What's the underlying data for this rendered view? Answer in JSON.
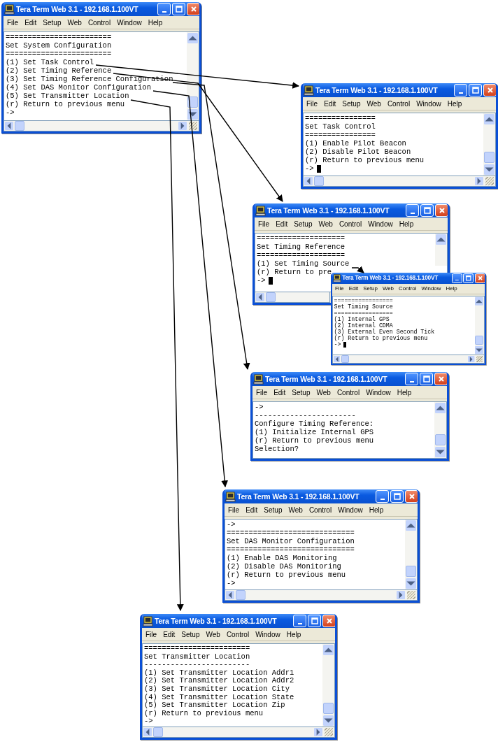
{
  "windows": [
    {
      "title": "Tera Term Web 3.1 - 192.168.1.100VT",
      "menu": [
        "File",
        "Edit",
        "Setup",
        "Web",
        "Control",
        "Window",
        "Help"
      ],
      "lines": [
        "========================",
        "Set System Configuration",
        "========================",
        "(1) Set Task Control",
        "(2) Set Timing Reference",
        "(3) Set Timing Reference Configuration",
        "(4) Set DAS Monitor Configuration",
        "(5) Set Transmitter Location",
        "(r) Return to previous menu",
        "->"
      ],
      "cursor": false
    },
    {
      "title": "Tera Term Web 3.1 - 192.168.1.100VT",
      "menu": [
        "File",
        "Edit",
        "Setup",
        "Web",
        "Control",
        "Window",
        "Help"
      ],
      "lines": [
        "================",
        "Set Task Control",
        "================",
        "(1) Enable Pilot Beacon",
        "(2) Disable Pilot Beacon",
        "(r) Return to previous menu",
        "->"
      ],
      "cursor": true
    },
    {
      "title": "Tera Term Web 3.1 - 192.168.1.100VT",
      "menu": [
        "File",
        "Edit",
        "Setup",
        "Web",
        "Control",
        "Window",
        "Help"
      ],
      "lines": [
        "====================",
        "Set Timing Reference",
        "====================",
        "(1) Set Timing Source",
        "(r) Return to pre",
        "->"
      ],
      "cursor": true
    },
    {
      "title": "Tera Term Web 3.1 - 192.168.1.100VT",
      "menu": [
        "File",
        "Edit",
        "Setup",
        "Web",
        "Control",
        "Window",
        "Help"
      ],
      "lines": [
        "=================",
        "Set Timing Source",
        "=================",
        "(1) Internal GPS",
        "(2) Internal CDMA",
        "(3) External Even Second Tick",
        "(r) Return to previous menu",
        "->"
      ],
      "cursor": true
    },
    {
      "title": "Tera Term Web 3.1 - 192.168.1.100VT",
      "menu": [
        "File",
        "Edit",
        "Setup",
        "Web",
        "Control",
        "Window",
        "Help"
      ],
      "lines": [
        "->",
        "-----------------------",
        "Configure Timing Reference:",
        "(1) Initialize Internal GPS",
        "(r) Return to previous menu",
        "Selection?"
      ],
      "cursor": false
    },
    {
      "title": "Tera Term Web 3.1 - 192.168.1.100VT",
      "menu": [
        "File",
        "Edit",
        "Setup",
        "Web",
        "Control",
        "Window",
        "Help"
      ],
      "lines": [
        "->",
        "=============================",
        "Set DAS Monitor Configuration",
        "=============================",
        "(1) Enable DAS Monitoring",
        "(2) Disable DAS Monitoring",
        "(r) Return to previous menu",
        "->"
      ],
      "cursor": false
    },
    {
      "title": "Tera Term Web 3.1 - 192.168.1.100VT",
      "menu": [
        "File",
        "Edit",
        "Setup",
        "Web",
        "Control",
        "Window",
        "Help"
      ],
      "lines": [
        "========================",
        "Set Transmitter Location",
        "------------------------",
        "(1) Set Transmitter Location Addr1",
        "(2) Set Transmitter Location Addr2",
        "(3) Set Transmitter Location City",
        "(4) Set Transmitter Location State",
        "(5) Set Transmitter Location Zip",
        "(r) Return to previous menu",
        "->"
      ],
      "cursor": false
    }
  ]
}
